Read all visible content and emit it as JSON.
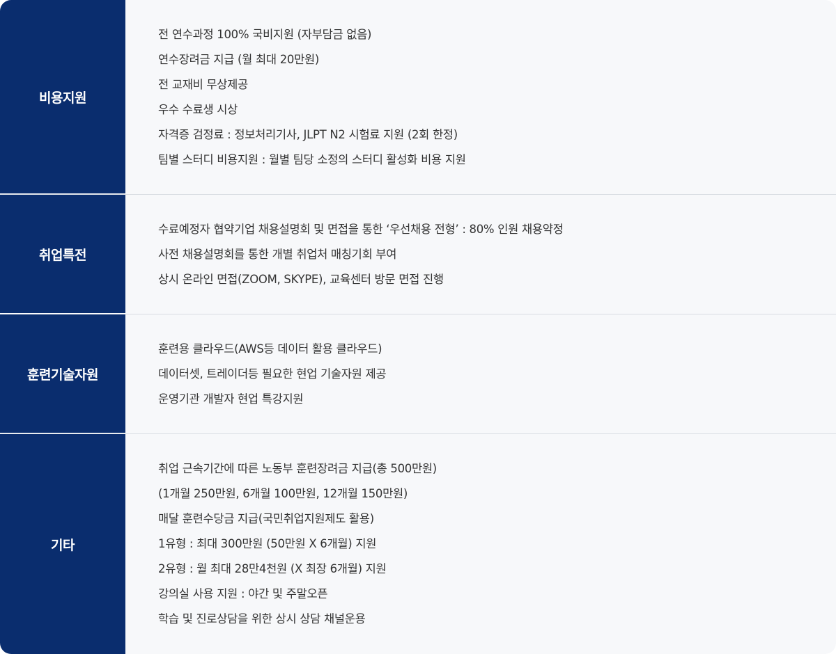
{
  "sections": [
    {
      "label": "비용지원",
      "items": [
        "전 연수과정 100% 국비지원 (자부담금 없음)",
        "연수장려금 지급 (월 최대 20만원)",
        "전 교재비 무상제공",
        "우수 수료생 시상",
        "자격증 검정료 : 정보처리기사, JLPT N2 시험료 지원 (2회 한정)",
        "팀별 스터디 비용지원 : 월별 팀당 소정의 스터디 활성화 비용 지원"
      ]
    },
    {
      "label": "취업특전",
      "items": [
        "수료예정자 협약기업 채용설명회 및 면접을 통한 ‘우선채용 전형’ : 80% 인원 채용약정",
        "사전 채용설명회를 통한 개별 취업처 매칭기회 부여",
        "상시 온라인 면접(ZOOM, SKYPE), 교육센터 방문 면접 진행"
      ]
    },
    {
      "label": "훈련기술자원",
      "items": [
        "훈련용 클라우드(AWS등 데이터 활용 클라우드)",
        "데이터셋, 트레이더등 필요한 현업 기술자원 제공",
        "운영기관 개발자 현업 특강지원"
      ]
    },
    {
      "label": "기타",
      "items": [
        "취업 근속기간에 따른 노동부 훈련장려금 지급(총 500만원)",
        "(1개월 250만원, 6개월 100만원, 12개월 150만원)",
        "매달 훈련수당금 지급(국민취업지원제도 활용)",
        "1유형 : 최대 300만원 (50만원 X 6개월) 지원",
        "2유형 : 월 최대 28만4천원 (X 최장 6개월) 지원",
        "강의실 사용 지원 : 야간 및 주말오픈",
        "학습 및 진로상담을 위한 상시 상담 채널운용"
      ]
    }
  ],
  "colors": {
    "label_bg": "#0a2d6e",
    "label_text": "#ffffff",
    "content_bg": "#f7f8fa",
    "content_text": "#333333",
    "divider": "#d9dde3"
  }
}
